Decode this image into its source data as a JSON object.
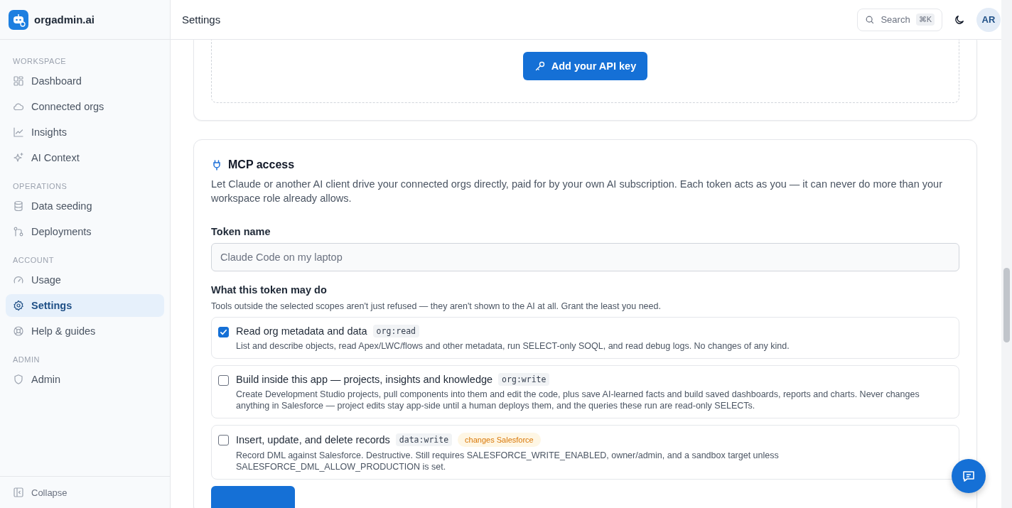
{
  "brand": {
    "name": "orgadmin.ai"
  },
  "sidebar": {
    "sections": [
      {
        "heading": "WORKSPACE",
        "items": [
          {
            "label": "Dashboard",
            "kind": "grid",
            "selected": false
          },
          {
            "label": "Connected orgs",
            "kind": "cloud",
            "selected": false
          },
          {
            "label": "Insights",
            "kind": "chart",
            "selected": false
          },
          {
            "label": "AI Context",
            "kind": "sparkle",
            "selected": false
          }
        ]
      },
      {
        "heading": "OPERATIONS",
        "items": [
          {
            "label": "Data seeding",
            "kind": "database",
            "selected": false
          },
          {
            "label": "Deployments",
            "kind": "branch",
            "selected": false
          }
        ]
      },
      {
        "heading": "ACCOUNT",
        "items": [
          {
            "label": "Usage",
            "kind": "gauge",
            "selected": false
          },
          {
            "label": "Settings",
            "kind": "gear",
            "selected": true
          },
          {
            "label": "Help & guides",
            "kind": "lifebuoy",
            "selected": false
          }
        ]
      },
      {
        "heading": "ADMIN",
        "items": [
          {
            "label": "Admin",
            "kind": "shield",
            "selected": false
          }
        ]
      }
    ],
    "collapse": "Collapse"
  },
  "header": {
    "title": "Settings",
    "search": {
      "placeholder": "Search",
      "shortcut": "⌘K"
    },
    "avatar": "AR"
  },
  "api_card": {
    "button": "Add your API key"
  },
  "mcp": {
    "title": "MCP access",
    "description": "Let Claude or another AI client drive your connected orgs directly, paid for by your own AI subscription. Each token acts as you — it can never do more than your workspace role already allows.",
    "token_name": {
      "label": "Token name",
      "placeholder": "Claude Code on my laptop"
    },
    "scopes_heading": "What this token may do",
    "scopes_hint": "Tools outside the selected scopes aren't just refused — they aren't shown to the AI at all. Grant the least you need.",
    "scopes": [
      {
        "title": "Read org metadata and data",
        "code": "org:read",
        "checked": true,
        "description": "List and describe objects, read Apex/LWC/flows and other metadata, run SELECT-only SOQL, and read debug logs. No changes of any kind."
      },
      {
        "title": "Build inside this app — projects, insights and knowledge",
        "code": "org:write",
        "checked": false,
        "description": "Create Development Studio projects, pull components into them and edit the code, plus save AI-learned facts and build saved dashboards, reports and charts. Never changes anything in Salesforce — project edits stay app-side until a human deploys them, and the queries these run are read-only SELECTs."
      },
      {
        "title": "Insert, update, and delete records",
        "code": "data:write",
        "checked": false,
        "tag": "changes Salesforce",
        "description": "Record DML against Salesforce. Destructive. Still requires SALESFORCE_WRITE_ENABLED, owner/admin, and a sandbox target unless SALESFORCE_DML_ALLOW_PRODUCTION is set."
      }
    ]
  }
}
